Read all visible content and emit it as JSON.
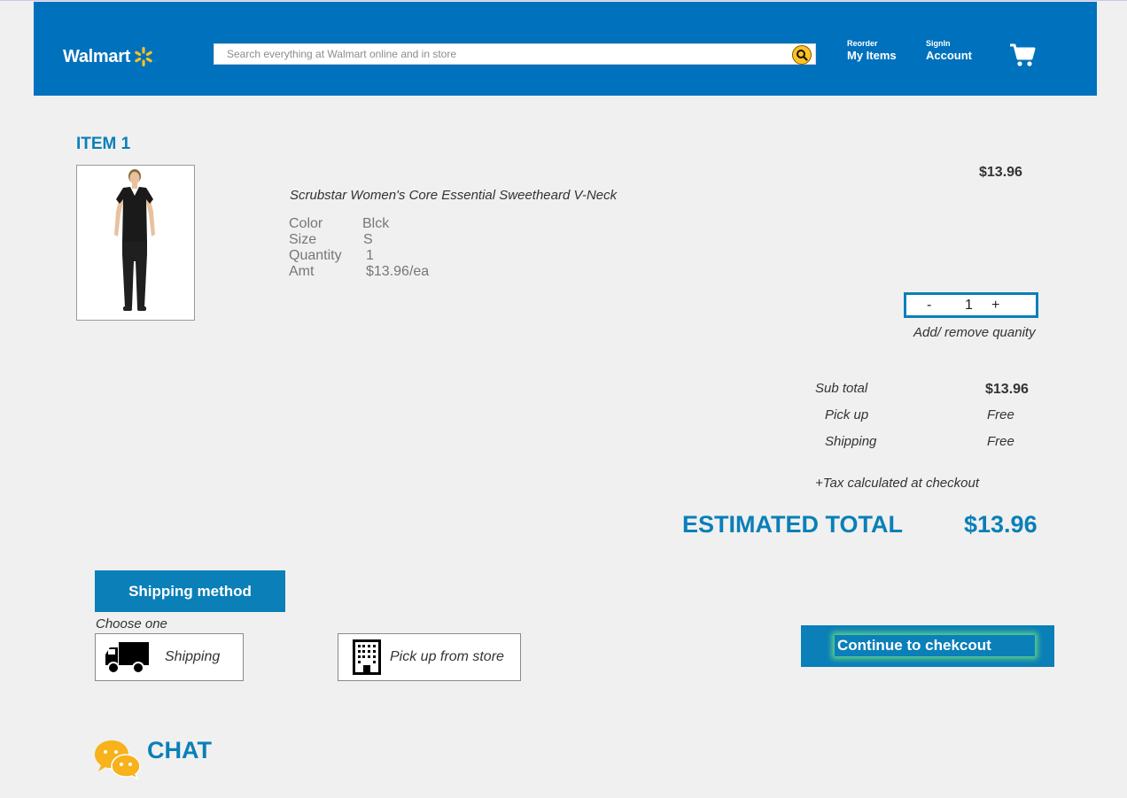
{
  "header": {
    "logo_text": "Walmart",
    "search_placeholder": "Search everything at Walmart online and in store",
    "reorder_small": "Reorder",
    "reorder_big": "My Items",
    "signin_small": "SignIn",
    "signin_big": "Account",
    "cart_icon": "cart-icon",
    "colors": {
      "bar": "#0071bc",
      "spark": "#ffc220"
    }
  },
  "item": {
    "title": "ITEM 1",
    "name": "Scrubstar Women's Core Essential Sweetheard V-Neck",
    "price": "$13.96",
    "attributes": [
      {
        "label": "Color",
        "value": "Blck"
      },
      {
        "label": "Size",
        "value": "S"
      },
      {
        "label": "Quantity",
        "value": "1"
      },
      {
        "label": "Amt",
        "value": "$13.96/ea"
      }
    ],
    "quantity": {
      "minus": "-",
      "value": "1",
      "plus": "+",
      "hint": "Add/ remove quanity"
    }
  },
  "summary": {
    "subtotal_label": "Sub total",
    "subtotal_value": "$13.96",
    "pickup_label": "Pick up",
    "pickup_value": "Free",
    "shipping_label": "Shipping",
    "shipping_value": "Free",
    "tax_note": "+Tax calculated at checkout",
    "estimated_label": "ESTIMATED TOTAL",
    "estimated_value": "$13.96"
  },
  "shipping_method": {
    "button_label": "Shipping method",
    "choose_label": "Choose one",
    "options": [
      {
        "label": "Shipping",
        "icon": "truck-icon"
      },
      {
        "label": "Pick up from store",
        "icon": "building-icon"
      }
    ]
  },
  "checkout": {
    "label": "Continue to chekcout"
  },
  "chat": {
    "label": "CHAT",
    "icon": "chat-bubbles-icon"
  },
  "accent_color": "#0a7fb8"
}
